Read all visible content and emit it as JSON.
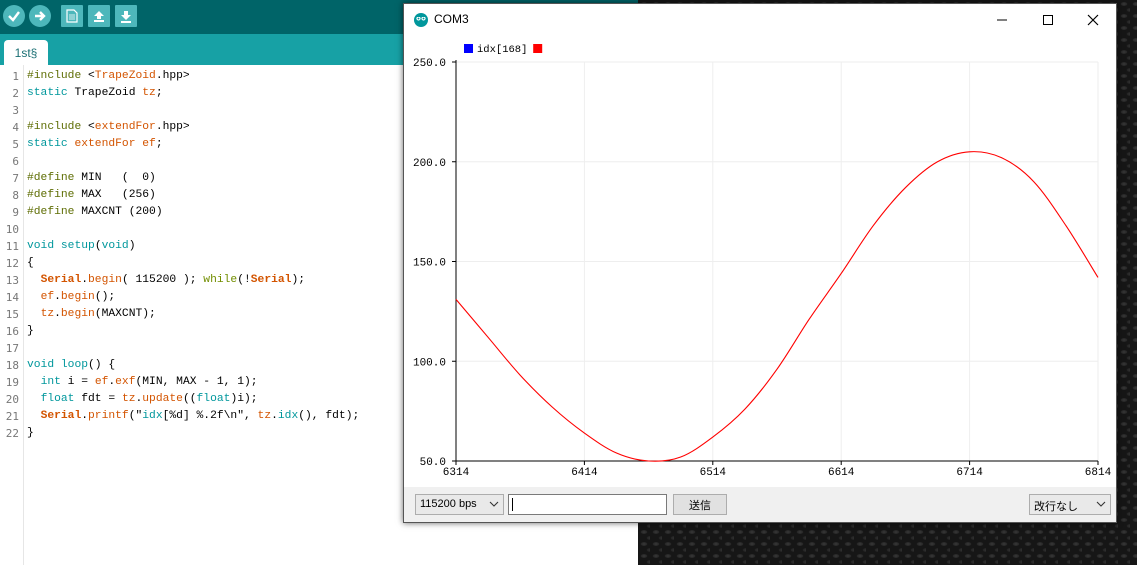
{
  "ide": {
    "tab_label": "1st§",
    "toolbar_icons": [
      "verify-icon",
      "upload-icon",
      "new-file-icon",
      "open-icon",
      "save-icon"
    ],
    "line_numbers": [
      "1",
      "2",
      "3",
      "4",
      "5",
      "6",
      "7",
      "8",
      "9",
      "10",
      "11",
      "12",
      "13",
      "14",
      "15",
      "16",
      "17",
      "18",
      "19",
      "20",
      "21",
      "22"
    ],
    "code_lines": [
      "#include <TrapeZoid.hpp>",
      "static TrapeZoid tz;",
      "",
      "#include <extendFor.hpp>",
      "static extendFor ef;",
      "",
      "#define MIN   (  0)",
      "#define MAX   (256)",
      "#define MAXCNT (200)",
      "",
      "void setup(void)",
      "{",
      "  Serial.begin( 115200 ); while(!Serial);",
      "  ef.begin();",
      "  tz.begin(MAXCNT);",
      "}",
      "",
      "void loop() {",
      "  int i = ef.exf(MIN, MAX - 1, 1);",
      "  float fdt = tz.update((float)i);",
      "  Serial.printf(\"idx[%d] %.2f\\n\", tz.idx(), fdt);",
      "}"
    ]
  },
  "plotter": {
    "window_title": "COM3",
    "controls": {
      "baud": "115200 bps",
      "send_value": "",
      "send_label": "送信",
      "line_ending": "改行なし"
    }
  },
  "chart_data": {
    "type": "line",
    "legend": [
      "idx[168]",
      ""
    ],
    "legend_colors": [
      "#0000ff",
      "#ff0000"
    ],
    "legend_placement": "top-left",
    "series": [
      {
        "color": "#ff0000",
        "x": [
          6314,
          6339,
          6364,
          6389,
          6414,
          6439,
          6464,
          6489,
          6514,
          6539,
          6564,
          6589,
          6614,
          6639,
          6664,
          6689,
          6714,
          6739,
          6764,
          6789,
          6814
        ],
        "y": [
          131,
          112,
          93,
          77,
          64,
          54,
          50,
          52,
          62,
          76,
          96,
          121,
          144,
          168,
          187,
          200,
          205,
          202,
          190,
          168,
          142
        ]
      }
    ],
    "xlim": [
      6314,
      6814
    ],
    "ylim": [
      50,
      250
    ],
    "x_ticks": [
      "6314",
      "6414",
      "6514",
      "6614",
      "6714",
      "6814"
    ],
    "y_ticks": [
      "50.0",
      "100.0",
      "150.0",
      "200.0",
      "250.0"
    ],
    "grid": true
  }
}
